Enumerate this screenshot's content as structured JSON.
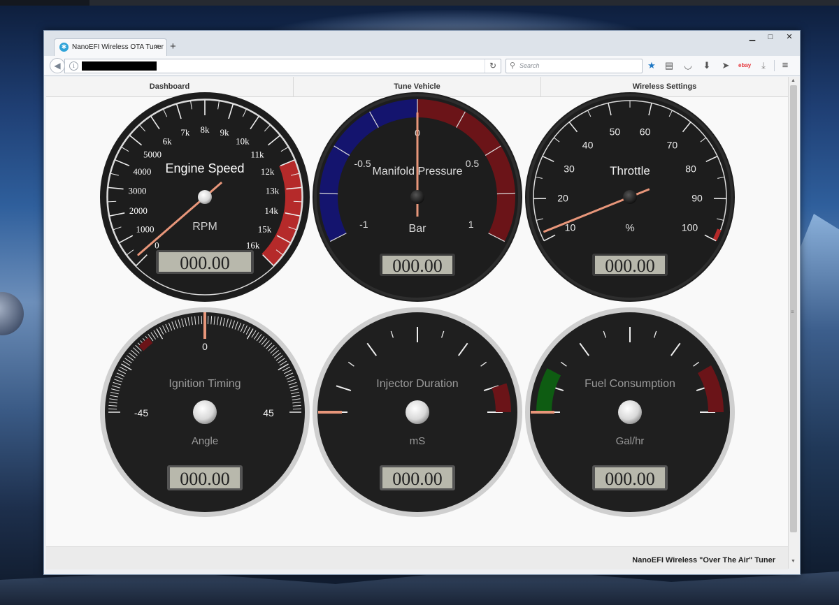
{
  "browser": {
    "tab_title": "NanoEFI Wireless OTA Tuner",
    "tab_close": "×",
    "new_tab": "+",
    "search_placeholder": "Search",
    "ebay_label": "ebay",
    "window_controls": {
      "minimize": "▁",
      "maximize": "□",
      "close": "✕"
    }
  },
  "nav": {
    "items": [
      "Dashboard",
      "Tune Vehicle",
      "Wireless Settings"
    ]
  },
  "footer": {
    "text": "NanoEFI Wireless \"Over The Air\" Tuner"
  },
  "gauges": {
    "engine_speed": {
      "title": "Engine Speed",
      "units": "RPM",
      "readout": "000.00",
      "tick_labels": [
        "0",
        "1000",
        "2000",
        "3000",
        "4000",
        "5000",
        "6k",
        "7k",
        "8k",
        "9k",
        "10k",
        "11k",
        "12k",
        "13k",
        "14k",
        "15k",
        "16k"
      ],
      "min": 0,
      "max": 16000,
      "redline_from": 12000,
      "value": 0
    },
    "manifold_pressure": {
      "title": "Manifold Pressure",
      "units": "Bar",
      "readout": "000.00",
      "tick_labels": [
        "-1",
        "-0.5",
        "0",
        "0.5",
        "1"
      ],
      "min": -1,
      "max": 1,
      "value": 0
    },
    "throttle": {
      "title": "Throttle",
      "units": "%",
      "readout": "000.00",
      "tick_labels": [
        "10",
        "20",
        "30",
        "40",
        "50",
        "60",
        "70",
        "80",
        "90",
        "100"
      ],
      "min": 10,
      "max": 100,
      "value": 10
    },
    "ignition_timing": {
      "title": "Ignition Timing",
      "units": "Angle",
      "readout": "000.00",
      "tick_labels": [
        "-45",
        "0",
        "45"
      ],
      "min": -45,
      "max": 45,
      "value": 0
    },
    "injector_duration": {
      "title": "Injector Duration",
      "units": "mS",
      "readout": "000.00",
      "value": 0
    },
    "fuel_consumption": {
      "title": "Fuel Consumption",
      "units": "Gal/hr",
      "readout": "000.00",
      "value": 0
    }
  },
  "colors": {
    "vacuum_band": "#14146e",
    "boost_band": "#6b1418",
    "redline": "#b52a2a",
    "needle": "#e8967a",
    "green_band": "#0e5c12"
  }
}
